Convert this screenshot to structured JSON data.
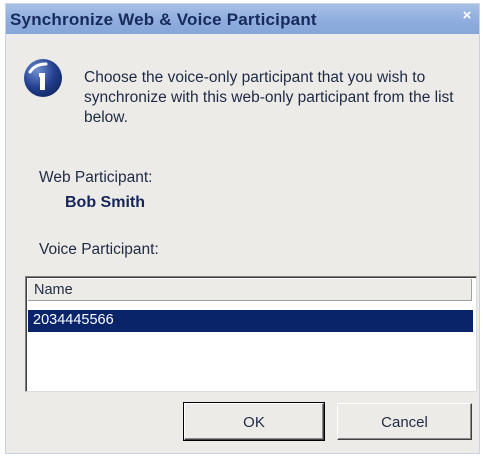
{
  "window": {
    "title": "Synchronize Web & Voice Participant",
    "close_glyph": "×"
  },
  "message": {
    "icon": "info-icon",
    "text": "Choose the voice-only participant that you wish to synchronize with this web-only participant from the list below."
  },
  "web_participant": {
    "label": "Web Participant:",
    "name": "Bob Smith"
  },
  "voice_participant": {
    "label": "Voice Participant:",
    "list": {
      "columns": [
        "Name"
      ],
      "rows": [
        "2034445566"
      ],
      "selected_row": 0
    }
  },
  "buttons": {
    "ok_label": "OK",
    "cancel_label": "Cancel"
  },
  "colors": {
    "titlebar": "#8fadde",
    "title_text": "#172a5c",
    "selection": "#0a246a",
    "dialog_bg": "#ecebe8"
  }
}
